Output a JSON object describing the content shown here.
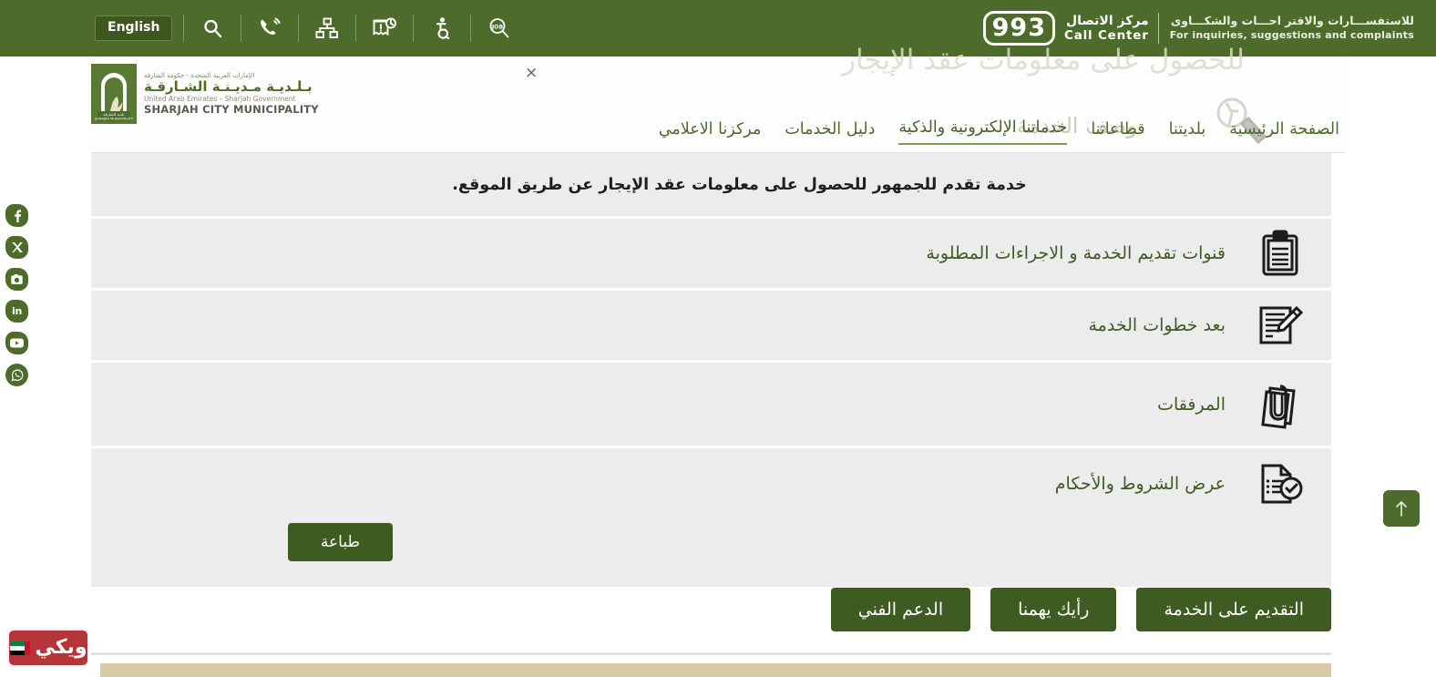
{
  "topbar": {
    "language_button": "English",
    "icons": [
      {
        "name": "search-icon",
        "label": "Search"
      },
      {
        "name": "phone-icon",
        "label": "Contact"
      },
      {
        "name": "sitemap-icon",
        "label": "Sitemap"
      },
      {
        "name": "ticket-clock-icon",
        "label": "Appointments"
      },
      {
        "name": "accessibility-icon",
        "label": "Accessibility"
      },
      {
        "name": "job-search-icon",
        "label": "Jobs"
      }
    ],
    "call_center": {
      "tagline_ar": "للاستفســـارات والاقتر احـــات والشكـــاوى",
      "tagline_en": "For inquiries, suggestions and complaints",
      "label_ar": "مركز الاتصال",
      "label_en": "Call Center",
      "number": "993"
    },
    "background_color": "#4d6b2a"
  },
  "header": {
    "logo": {
      "line_ar_small": "الإمارات العربية المتحدة - حكومة الشارقة",
      "line_ar_main": "بـلـديـة مـديـنـة الشـارقـة",
      "line_en_small": "United Arab Emirates – Sharjah Government",
      "line_en_main": "SHARJAH CITY MUNICIPALITY"
    },
    "watermark_top": "للحصول على معلومات عقد الإيجار",
    "watermark_sub": "وصف الخدمة",
    "close_label": "×",
    "nav": [
      {
        "label": "الصفحة الرئيسية",
        "active": false
      },
      {
        "label": "بلديتنا",
        "active": false
      },
      {
        "label": "قطاعاتنا",
        "active": false
      },
      {
        "label": "خدماتنا الإلكترونية والذكية",
        "active": true
      },
      {
        "label": "دليل الخدمات",
        "active": false
      },
      {
        "label": "مركزنا الاعلامي",
        "active": false
      }
    ]
  },
  "main": {
    "description": "خدمة تقدم للجمهور للحصول على معلومات عقد الإيجار عن طريق الموقع.",
    "accordion": [
      {
        "label": "قنوات تقديم الخدمة و الاجراءات المطلوبة",
        "icon": "clipboard-icon"
      },
      {
        "label": "بعد خطوات الخدمة",
        "icon": "document-pencil-icon"
      },
      {
        "label": "المرفقات",
        "icon": "paperclip-document-icon"
      },
      {
        "label": "عرض الشروط والأحكام",
        "icon": "document-check-icon"
      }
    ],
    "print_button": "طباعة",
    "actions": [
      {
        "label": "التقديم على الخدمة",
        "name": "apply-for-service-button"
      },
      {
        "label": "رأيك يهمنا",
        "name": "feedback-button"
      },
      {
        "label": "الدعم الفني",
        "name": "technical-support-button"
      }
    ]
  },
  "social": [
    {
      "name": "facebook-icon",
      "glyph": "f"
    },
    {
      "name": "x-twitter-icon",
      "glyph": "X"
    },
    {
      "name": "instagram-icon",
      "glyph": "◉"
    },
    {
      "name": "linkedin-icon",
      "glyph": "in"
    },
    {
      "name": "youtube-icon",
      "glyph": "You"
    },
    {
      "name": "whatsapp-icon",
      "glyph": "✆"
    }
  ],
  "wiki_badge": {
    "label": "ويكي"
  },
  "scroll_top": {
    "label": "↑"
  },
  "colors": {
    "brand_green": "#4d6b2a",
    "button_green": "#3e5c22",
    "row_gray": "#ececec",
    "accent_tan": "#d5c9a6",
    "wiki_red": "#b7353a"
  }
}
